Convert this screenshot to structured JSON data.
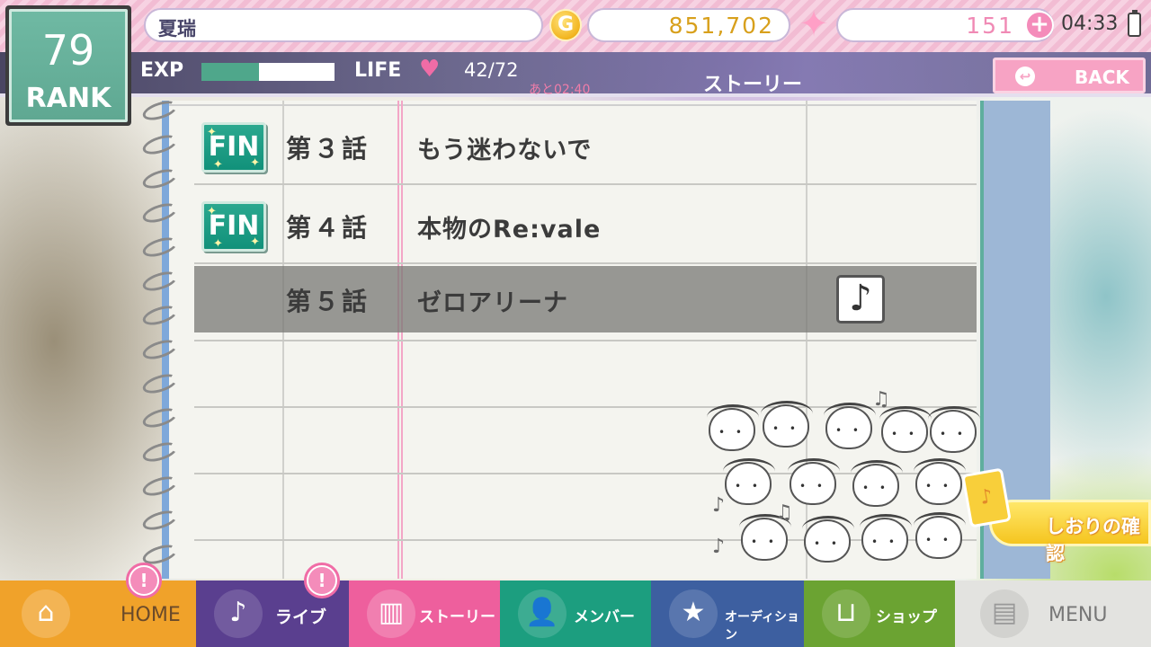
{
  "header": {
    "player_name": "夏瑞",
    "gold": "851,702",
    "stones": "151",
    "clock": "04:33",
    "coin_glyph": "G"
  },
  "rank": {
    "value": "79",
    "label": "RANK"
  },
  "status": {
    "exp_label": "EXP",
    "exp_progress": 0.43,
    "life_label": "LIFE",
    "life_value": "42/72",
    "life_timer": "あと02:40"
  },
  "screen": {
    "title": "ストーリー",
    "back_label": "BACK"
  },
  "story": {
    "episodes": [
      {
        "number": "第３話",
        "title": "もう迷わないで",
        "status": "FIN"
      },
      {
        "number": "第４話",
        "title": "本物のRe:vale",
        "status": "FIN"
      },
      {
        "number": "第５話",
        "title": "ゼロアリーナ",
        "status": ""
      }
    ],
    "bookmark_label": "しおりの確認"
  },
  "nav": {
    "home": "HOME",
    "live": "ライブ",
    "story": "ストーリー",
    "member": "メンバー",
    "audition": "オーディション",
    "shop": "ショップ",
    "menu": "MENU",
    "alert_glyph": "!"
  },
  "colors": {
    "home": "#f0a22a",
    "live": "#5a3f8f",
    "story": "#ee5f9d",
    "member": "#1c9e7f",
    "audition": "#3d5fa0",
    "shop": "#6ba332",
    "menu": "#e3e3e0",
    "accent_pink": "#f48cba",
    "fin_green": "#1a9b82"
  }
}
